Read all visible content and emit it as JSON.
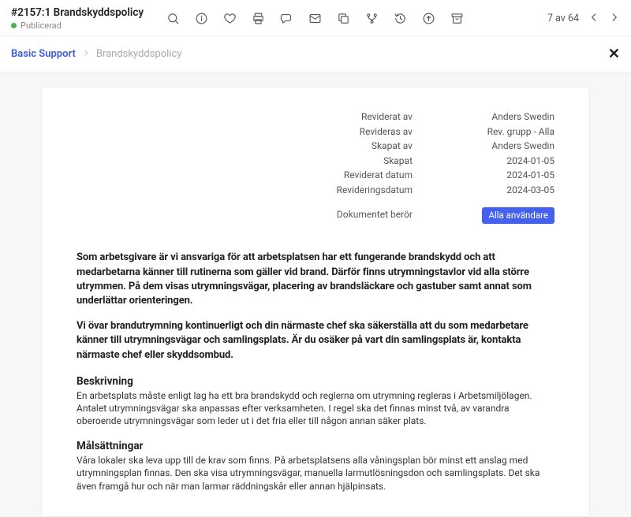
{
  "topbar": {
    "title": "#2157:1 Brandskyddspolicy",
    "status": "Publicerad",
    "pager": "7 av 64"
  },
  "breadcrumb": {
    "root": "Basic Support",
    "current": "Brandskyddspolicy"
  },
  "meta": {
    "rows": [
      {
        "label": "Reviderat av",
        "value": "Anders Swedin"
      },
      {
        "label": "Revideras av",
        "value": "Rev. grupp - Alla"
      },
      {
        "label": "Skapat av",
        "value": "Anders Swedin"
      },
      {
        "label": "Skapat",
        "value": "2024-01-05"
      },
      {
        "label": "Reviderat datum",
        "value": "2024-01-05"
      },
      {
        "label": "Revideringsdatum",
        "value": "2024-03-05"
      }
    ],
    "affects_label": "Dokumentet berör",
    "affects_badge": "Alla användare"
  },
  "content": {
    "intro1": "Som arbetsgivare är vi ansvariga för att arbetsplatsen har ett fungerande brandskydd och att medarbetarna känner till rutinerna som gäller vid brand. Därför finns utrymningstavlor vid alla större utrymmen. På dem visas utrymningsvägar, placering av brandsläckare och gastuber samt annat som underlättar orienteringen.",
    "intro2": "Vi övar brandutrymning kontinuerligt och din närmaste chef ska säkerställa att du som medarbetare känner till utrymningsvägar och samlingsplats. Är du osäker på vart din samlingsplats är, kontakta närmaste chef eller skyddsombud.",
    "h1": "Beskrivning",
    "p1": "En arbetsplats måste enligt lag ha ett bra brandskydd och reglerna om utrymning regleras i Arbetsmiljölagen. Antalet utrymningsvägar ska anpassas efter verksamheten. I regel ska det finnas minst två, av varandra oberoende utrymningsvägar som leder ut i det fria eller till någon annan säker plats.",
    "h2": "Målsättningar",
    "p2": "Våra lokaler ska leva upp till de krav som finns. På arbetsplatsens alla våningsplan bör minst ett anslag med utrymningsplan finnas. Den ska visa utrymningsvägar, manuella larmutlösningsdon och samlingsplats. Det ska även framgå hur och när man larmar räddningskår eller annan hjälpinsats."
  }
}
